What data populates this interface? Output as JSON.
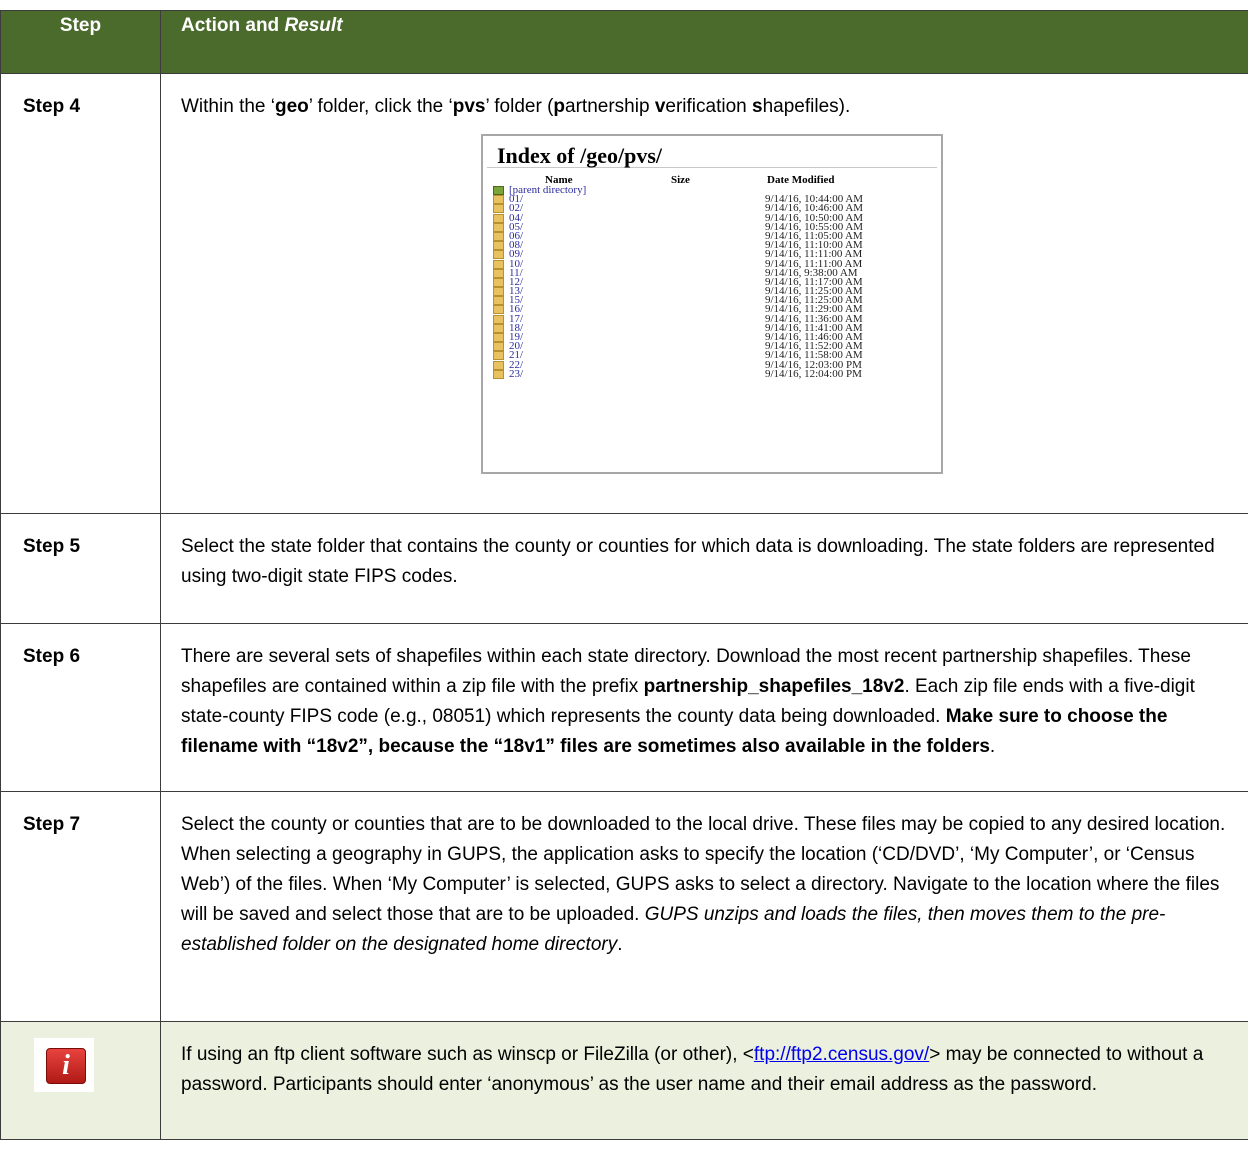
{
  "header": {
    "col1": "Step",
    "col2_prefix": "Action and ",
    "col2_italic": "Result"
  },
  "step4": {
    "label": "Step 4",
    "t1": "Within the ‘",
    "b1": "geo",
    "t2": "’ folder, click the ‘",
    "b2": "pvs",
    "t3": "’ folder (",
    "b3": "p",
    "t4": "artnership ",
    "b4": "v",
    "t5": "erification ",
    "b5": "s",
    "t6": "hapefiles).",
    "listing": {
      "title": "Index of /geo/pvs/",
      "col_name": "Name",
      "col_size": "Size",
      "col_date": "Date Modified",
      "parent": "[parent directory]",
      "rows": [
        {
          "name": "01/",
          "date": "9/14/16, 10:44:00 AM"
        },
        {
          "name": "02/",
          "date": "9/14/16, 10:46:00 AM"
        },
        {
          "name": "04/",
          "date": "9/14/16, 10:50:00 AM"
        },
        {
          "name": "05/",
          "date": "9/14/16, 10:55:00 AM"
        },
        {
          "name": "06/",
          "date": "9/14/16, 11:05:00 AM"
        },
        {
          "name": "08/",
          "date": "9/14/16, 11:10:00 AM"
        },
        {
          "name": "09/",
          "date": "9/14/16, 11:11:00 AM"
        },
        {
          "name": "10/",
          "date": "9/14/16, 11:11:00 AM"
        },
        {
          "name": "11/",
          "date": "9/14/16, 9:38:00 AM"
        },
        {
          "name": "12/",
          "date": "9/14/16, 11:17:00 AM"
        },
        {
          "name": "13/",
          "date": "9/14/16, 11:25:00 AM"
        },
        {
          "name": "15/",
          "date": "9/14/16, 11:25:00 AM"
        },
        {
          "name": "16/",
          "date": "9/14/16, 11:29:00 AM"
        },
        {
          "name": "17/",
          "date": "9/14/16, 11:36:00 AM"
        },
        {
          "name": "18/",
          "date": "9/14/16, 11:41:00 AM"
        },
        {
          "name": "19/",
          "date": "9/14/16, 11:46:00 AM"
        },
        {
          "name": "20/",
          "date": "9/14/16, 11:52:00 AM"
        },
        {
          "name": "21/",
          "date": "9/14/16, 11:58:00 AM"
        },
        {
          "name": "22/",
          "date": "9/14/16, 12:03:00 PM"
        },
        {
          "name": "23/",
          "date": "9/14/16, 12:04:00 PM"
        }
      ]
    }
  },
  "step5": {
    "label": "Step 5",
    "text": "Select the state folder that contains the county or counties for which data is downloading. The state folders are represented using two-digit state FIPS codes."
  },
  "step6": {
    "label": "Step 6",
    "t1": "There are several sets of shapefiles within each state directory. Download the most recent partnership shapefiles. These shapefiles are contained within a zip file with the prefix ",
    "b1": "partnership_shapefiles_18v2",
    "t2": ". Each zip file ends with a five-digit state-county FIPS code (e.g., 08051) which represents the county data being downloaded. ",
    "b2": "Make sure to choose the filename with “18v2”, because the “18v1” files are sometimes also available in the folders",
    "t3": "."
  },
  "step7": {
    "label": "Step 7",
    "t1": "Select the county or counties that are to be downloaded to the local drive. These files may be copied to any desired location. When selecting a geography in GUPS, the application asks to specify the location (‘CD/DVD’, ‘My Computer’, or ‘Census Web’) of the files. When ‘My Computer’ is selected, GUPS asks to select a directory. Navigate to the location where the files will be saved and select those that are to be uploaded. ",
    "i1": "GUPS unzips and loads the files, then moves them to the pre-established folder on the designated home directory",
    "t2": "."
  },
  "note": {
    "icon": "info-icon",
    "icon_letter": "i",
    "t1": "If using an ftp client software such as winscp or FileZilla (or other), <",
    "link": "ftp://ftp2.census.gov/",
    "t2": "> may be connected to without a password. Participants should enter ‘anonymous’ as the user name and their email address as the password."
  },
  "colors": {
    "header_bg": "#4b6b2d",
    "note_bg": "#ebf1de",
    "border": "#3c3c3c"
  }
}
